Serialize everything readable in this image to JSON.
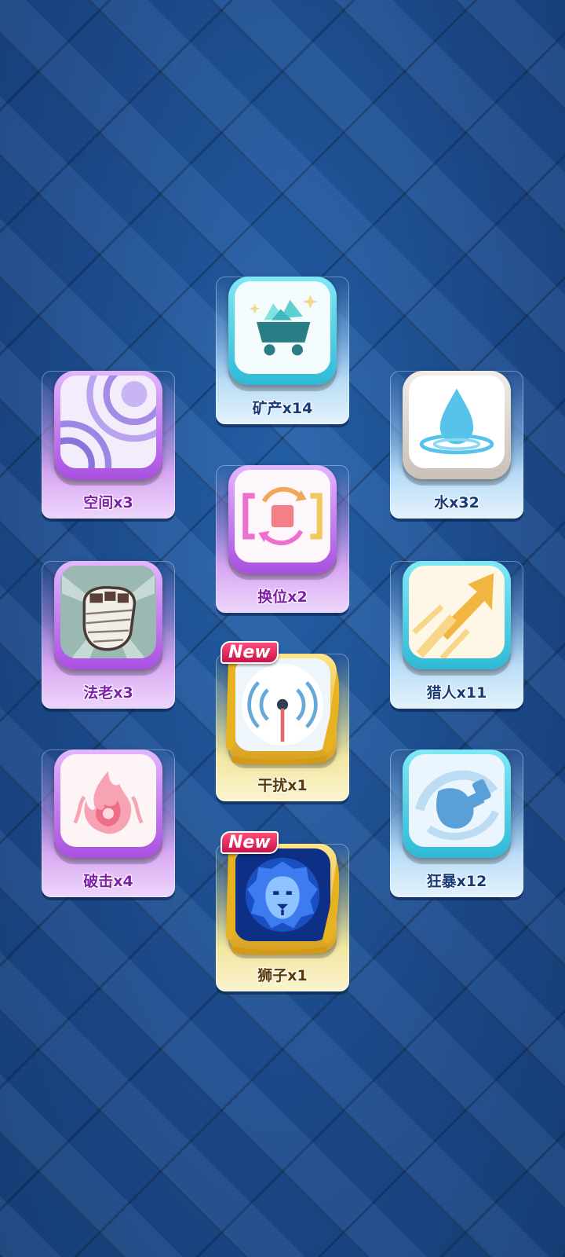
{
  "cards": [
    {
      "id": "kuangchan",
      "label": "矿产x14",
      "theme": "blue",
      "tile": "cyan",
      "icon": "minecart-crystals-icon",
      "is_new": false
    },
    {
      "id": "kongjian",
      "label": "空间x3",
      "theme": "purple",
      "tile": "purple",
      "icon": "space-ripple-icon",
      "is_new": false
    },
    {
      "id": "shui",
      "label": "水x32",
      "theme": "blue",
      "tile": "grey",
      "icon": "water-drop-icon",
      "is_new": false
    },
    {
      "id": "huanwei",
      "label": "换位x2",
      "theme": "purple",
      "tile": "purple",
      "icon": "swap-arrows-icon",
      "is_new": false
    },
    {
      "id": "falao",
      "label": "法老x3",
      "theme": "purple",
      "tile": "purple",
      "icon": "bandaged-fist-icon",
      "is_new": false
    },
    {
      "id": "lieren",
      "label": "猎人x11",
      "theme": "blue",
      "tile": "cyan",
      "icon": "arrow-shot-icon",
      "is_new": false
    },
    {
      "id": "ganrao",
      "label": "干扰x1",
      "theme": "gold",
      "tile": "gold",
      "icon": "signal-antenna-icon",
      "is_new": true
    },
    {
      "id": "poji",
      "label": "破击x4",
      "theme": "purple",
      "tile": "purple",
      "icon": "flame-icon",
      "is_new": false
    },
    {
      "id": "kuangbao",
      "label": "狂暴x12",
      "theme": "blue",
      "tile": "cyan",
      "icon": "hammer-swirl-icon",
      "is_new": false
    },
    {
      "id": "shizi",
      "label": "狮子x1",
      "theme": "gold",
      "tile": "gold",
      "icon": "lion-head-icon",
      "is_new": true
    }
  ],
  "badge_text": "New",
  "colors": {
    "background": "#1e4f92",
    "purple_card": "#d9a8f3",
    "blue_card": "#b8dcf7",
    "gold_card": "#f2e6a0",
    "new_badge": "#e0215a"
  }
}
